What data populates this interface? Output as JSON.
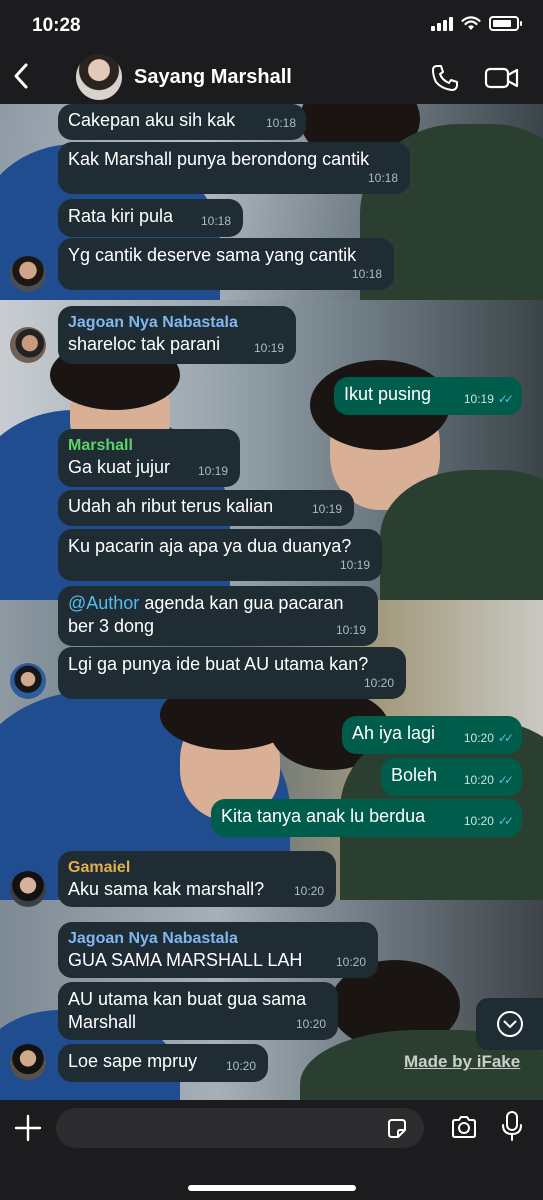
{
  "status_bar": {
    "time": "10:28"
  },
  "header": {
    "contact_name": "Sayang Marshall"
  },
  "messages": [
    {
      "text": "Cakepan aku sih kak",
      "time": "10:18"
    },
    {
      "text": "Kak Marshall punya berondong cantik",
      "time": "10:18"
    },
    {
      "text": "Rata kiri pula",
      "time": "10:18"
    },
    {
      "text": "Yg cantik deserve sama yang cantik",
      "time": "10:18"
    },
    {
      "sender": "Jagoan Nya Nabastala",
      "text": "shareloc tak parani",
      "time": "10:19"
    },
    {
      "text": "Ikut pusing",
      "time": "10:19"
    },
    {
      "sender": "Marshall",
      "text": "Ga kuat jujur",
      "time": "10:19"
    },
    {
      "text": "Udah ah ribut terus kalian",
      "time": "10:19"
    },
    {
      "text": "Ku pacarin aja apa ya dua duanya?",
      "time": "10:19"
    },
    {
      "mention": "@Author",
      "text": " agenda kan gua pacaran",
      "text2": "ber 3 dong",
      "time": "10:19"
    },
    {
      "text": "Lgi ga punya ide buat AU utama kan?",
      "time": "10:20"
    },
    {
      "text": "Ah iya lagi",
      "time": "10:20"
    },
    {
      "text": "Boleh",
      "time": "10:20"
    },
    {
      "text": "Kita tanya anak lu berdua",
      "time": "10:20"
    },
    {
      "sender": "Gamaiel",
      "text": "Aku sama kak marshall?",
      "time": "10:20"
    },
    {
      "sender": "Jagoan Nya Nabastala",
      "text": "GUA SAMA MARSHALL LAH",
      "time": "10:20"
    },
    {
      "text": "AU utama kan buat gua sama",
      "text2": "Marshall",
      "time": "10:20"
    },
    {
      "text": "Loe sape mpruy",
      "time": "10:20"
    }
  ],
  "watermark": "Made by iFake",
  "composer": {
    "placeholder": ""
  },
  "colors": {
    "incoming_bubble": "#1f2c34",
    "outgoing_bubble": "#005c4b",
    "sender_blue": "#7fb8f0",
    "sender_green": "#5ed06a",
    "sender_gold": "#e0b050",
    "read_ticks": "#53bdeb"
  },
  "icons": [
    "back-chevron-icon",
    "phone-icon",
    "video-camera-icon",
    "plus-icon",
    "sticker-icon",
    "camera-icon",
    "microphone-icon",
    "chevron-down-icon"
  ]
}
